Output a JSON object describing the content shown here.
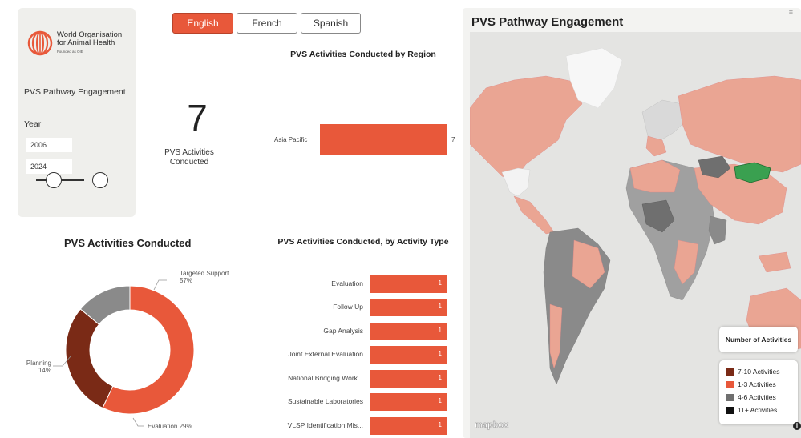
{
  "colors": {
    "accent": "#e8583a",
    "dark_brown": "#7a2a16",
    "gray": "#8a8a8a",
    "black": "#111111",
    "green": "#3aa050"
  },
  "logo": {
    "line1": "World Organisation",
    "line2": "for Animal Health",
    "line3": "Founded as OIE"
  },
  "sidebar": {
    "subtitle": "PVS Pathway Engagement",
    "year_label": "Year",
    "year_start": "2006",
    "year_end": "2024"
  },
  "languages": [
    {
      "label": "English",
      "active": true
    },
    {
      "label": "French",
      "active": false
    },
    {
      "label": "Spanish",
      "active": false
    }
  ],
  "kpi": {
    "value": "7",
    "label": "PVS Activities Conducted"
  },
  "region_chart": {
    "title": "PVS Activities Conducted by Region",
    "category": "Asia Pacific",
    "value": "7"
  },
  "donut": {
    "title": "PVS Activities Conducted",
    "labels": {
      "targeted_name": "Targeted Support",
      "targeted_pct": "57%",
      "planning_name": "Planning",
      "planning_pct": "14%",
      "evaluation": "Evaluation 29%"
    }
  },
  "activity_chart": {
    "title": "PVS Activities Conducted, by Activity Type",
    "rows": [
      {
        "label": "Evaluation",
        "value": "1"
      },
      {
        "label": "Follow Up",
        "value": "1"
      },
      {
        "label": "Gap Analysis",
        "value": "1"
      },
      {
        "label": "Joint External Evaluation",
        "value": "1"
      },
      {
        "label": "National Bridging Work...",
        "value": "1"
      },
      {
        "label": "Sustainable Laboratories",
        "value": "1"
      },
      {
        "label": "VLSP Identification Mis...",
        "value": "1"
      }
    ]
  },
  "map": {
    "title": "PVS Pathway Engagement",
    "legend_title": "Number of Activities",
    "legend": [
      {
        "label": "7-10 Activities",
        "color": "#7a2a16"
      },
      {
        "label": "1-3 Activities",
        "color": "#e8583a"
      },
      {
        "label": "4-6 Activities",
        "color": "#6f6f6f"
      },
      {
        "label": "11+ Activities",
        "color": "#111111"
      }
    ],
    "attribution": "mapbox"
  },
  "chart_data": [
    {
      "type": "pie",
      "title": "PVS Activities Conducted",
      "categories": [
        "Targeted Support",
        "Evaluation",
        "Planning"
      ],
      "values": [
        57,
        29,
        14
      ],
      "colors": [
        "#e8583a",
        "#7a2a16",
        "#8a8a8a"
      ]
    },
    {
      "type": "bar",
      "title": "PVS Activities Conducted by Region",
      "categories": [
        "Asia Pacific"
      ],
      "values": [
        7
      ],
      "xlim": [
        0,
        7
      ]
    },
    {
      "type": "bar",
      "title": "PVS Activities Conducted, by Activity Type",
      "categories": [
        "Evaluation",
        "Follow Up",
        "Gap Analysis",
        "Joint External Evaluation",
        "National Bridging Work...",
        "Sustainable Laboratories",
        "VLSP Identification Mis..."
      ],
      "values": [
        1,
        1,
        1,
        1,
        1,
        1,
        1
      ],
      "xlim": [
        0,
        1
      ]
    }
  ]
}
